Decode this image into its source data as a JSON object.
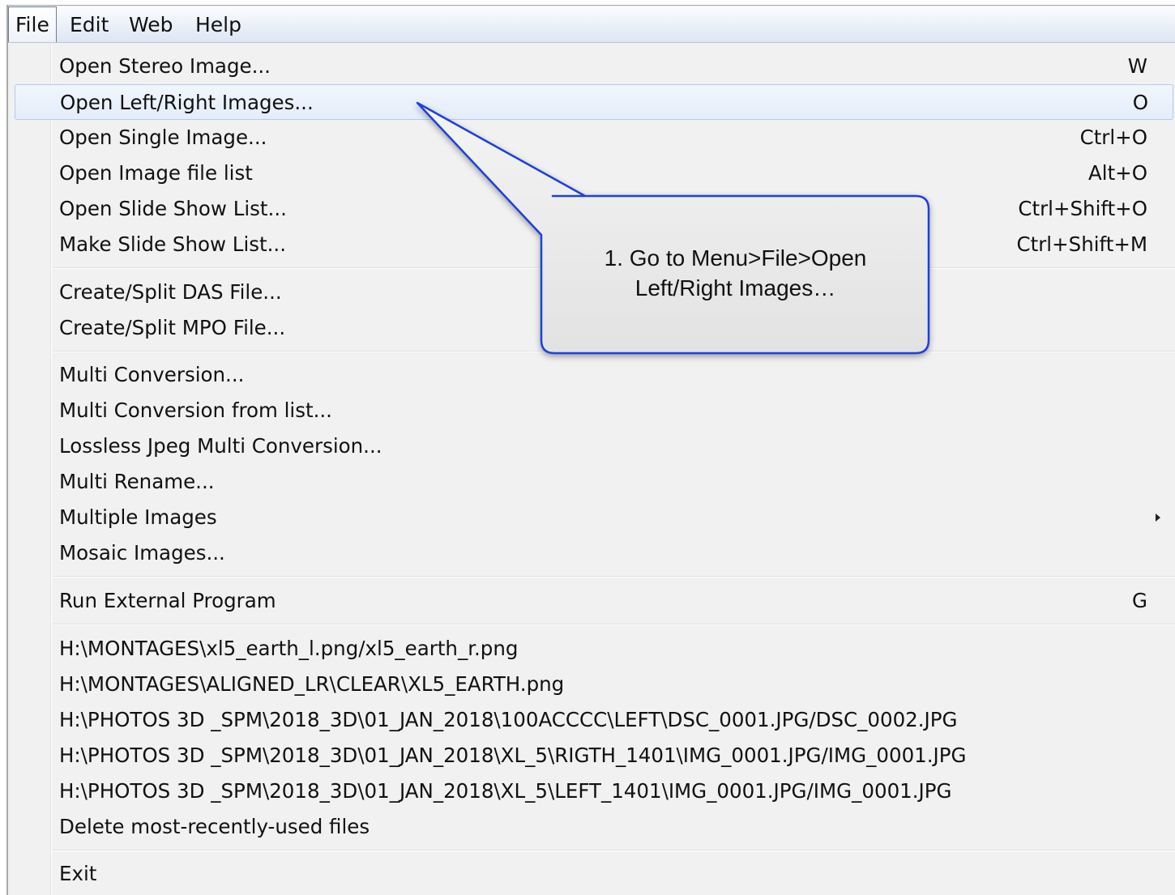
{
  "menubar": {
    "items": [
      "File",
      "Edit",
      "Web",
      "Help"
    ]
  },
  "menu": {
    "items": [
      {
        "label": "Open Stereo Image...",
        "shortcut": "W"
      },
      {
        "label": "Open Left/Right Images...",
        "shortcut": "O"
      },
      {
        "label": "Open Single Image...",
        "shortcut": "Ctrl+O"
      },
      {
        "label": "Open Image file list",
        "shortcut": "Alt+O"
      },
      {
        "label": "Open Slide Show List...",
        "shortcut": "Ctrl+Shift+O"
      },
      {
        "label": "Make Slide Show List...",
        "shortcut": "Ctrl+Shift+M"
      },
      {
        "label": "Create/Split DAS File..."
      },
      {
        "label": "Create/Split MPO File..."
      },
      {
        "label": "Multi Conversion..."
      },
      {
        "label": "Multi Conversion from list..."
      },
      {
        "label": "Lossless Jpeg Multi Conversion..."
      },
      {
        "label": "Multi Rename..."
      },
      {
        "label": "Multiple Images"
      },
      {
        "label": "Mosaic Images..."
      },
      {
        "label": "Run External Program",
        "shortcut": "G"
      },
      {
        "label": "H:\\MONTAGES\\xl5_earth_l.png/xl5_earth_r.png"
      },
      {
        "label": "H:\\MONTAGES\\ALIGNED_LR\\CLEAR\\XL5_EARTH.png"
      },
      {
        "label": "H:\\PHOTOS 3D _SPM\\2018_3D\\01_JAN_2018\\100ACCCC\\LEFT\\DSC_0001.JPG/DSC_0002.JPG"
      },
      {
        "label": "H:\\PHOTOS 3D _SPM\\2018_3D\\01_JAN_2018\\XL_5\\RIGTH_1401\\IMG_0001.JPG/IMG_0001.JPG"
      },
      {
        "label": "H:\\PHOTOS 3D _SPM\\2018_3D\\01_JAN_2018\\XL_5\\LEFT_1401\\IMG_0001.JPG/IMG_0001.JPG"
      },
      {
        "label": "Delete most-recently-used files"
      },
      {
        "label": "Exit"
      }
    ]
  },
  "callout": {
    "line1": "1. Go to Menu>File>Open",
    "line2": "Left/Right Images…"
  },
  "colors": {
    "highlight_bg": "#e4edfa",
    "highlight_border": "#b3cbe8",
    "callout_border": "#1a3fe0",
    "callout_fill": "#ececec"
  }
}
